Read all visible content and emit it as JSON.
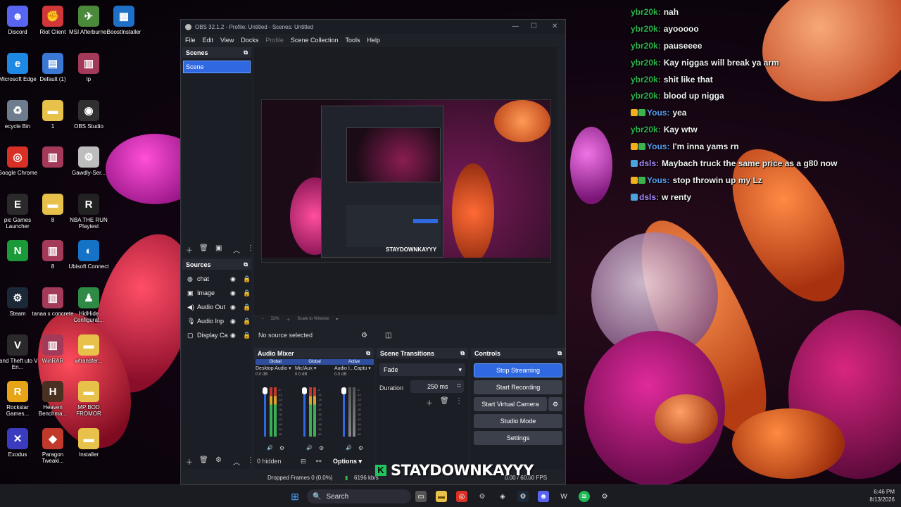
{
  "desktop": {
    "icons": [
      {
        "label": "Discord",
        "glyph": "☻",
        "color": "#5865f2"
      },
      {
        "label": "Riot Client",
        "glyph": "✊",
        "color": "#d13639"
      },
      {
        "label": "MSI Afterburner",
        "glyph": "✈",
        "color": "#4a8a3a"
      },
      {
        "label": "BoostInstaller",
        "glyph": "▦",
        "color": "#1f6fc5"
      },
      {
        "label": "Microsoft Edge",
        "glyph": "e",
        "color": "#1e88e5"
      },
      {
        "label": "Default (1)",
        "glyph": "▤",
        "color": "#3a78d4"
      },
      {
        "label": "lp",
        "glyph": "▥",
        "color": "#a33a5a"
      },
      {
        "label": "ecycle Bin",
        "glyph": "♻",
        "color": "#6e7d8e"
      },
      {
        "label": "1",
        "glyph": "▬",
        "color": "#e7c14a"
      },
      {
        "label": "OBS Studio",
        "glyph": "◉",
        "color": "#303030"
      },
      {
        "label": "Google Chrome",
        "glyph": "◎",
        "color": "#d93025"
      },
      {
        "label": "",
        "glyph": "▥",
        "color": "#a33a5a"
      },
      {
        "label": "Gawdly-Ser...",
        "glyph": "⚙",
        "color": "#bdbdbd"
      },
      {
        "label": "pic Games Launcher",
        "glyph": "E",
        "color": "#2a2a2a"
      },
      {
        "label": "8",
        "glyph": "▬",
        "color": "#e7c14a"
      },
      {
        "label": "NBA THE RUN Playtest",
        "glyph": "R",
        "color": "#222"
      },
      {
        "label": "",
        "glyph": "N",
        "color": "#1b9a3a"
      },
      {
        "label": "8",
        "glyph": "▥",
        "color": "#a33a5a"
      },
      {
        "label": "Ubisoft Connect",
        "glyph": "◐",
        "color": "#1573c7"
      },
      {
        "label": "Steam",
        "glyph": "⚙",
        "color": "#1b2838"
      },
      {
        "label": "tanaa x concrete",
        "glyph": "▥",
        "color": "#a33a5a"
      },
      {
        "label": "HidHide Configurat...",
        "glyph": "♟",
        "color": "#2f8a45"
      },
      {
        "label": "rand Theft uto V En...",
        "glyph": "V",
        "color": "#2a2a2a"
      },
      {
        "label": "WinRAR",
        "glyph": "▥",
        "color": "#a33a5a"
      },
      {
        "label": "wtransfer...",
        "glyph": "▬",
        "color": "#e7c14a"
      },
      {
        "label": "Rockstar Games...",
        "glyph": "R",
        "color": "#e6a416"
      },
      {
        "label": "Heaven Benchma...",
        "glyph": "H",
        "color": "#4a3020"
      },
      {
        "label": "MP BOD FROMOR",
        "glyph": "▬",
        "color": "#e7c14a"
      },
      {
        "label": "Exodus",
        "glyph": "✕",
        "color": "#3b3bc0"
      },
      {
        "label": "Paragon Tweaki...",
        "glyph": "◆",
        "color": "#c0392b"
      },
      {
        "label": "Installer",
        "glyph": "▬",
        "color": "#e7c14a"
      }
    ]
  },
  "chat": {
    "messages": [
      {
        "user": "ybr20k:",
        "user_color": "#2fb24e",
        "text": "nah",
        "badges": []
      },
      {
        "user": "ybr20k:",
        "user_color": "#2fb24e",
        "text": "ayooooo",
        "badges": []
      },
      {
        "user": "ybr20k:",
        "user_color": "#2fb24e",
        "text": "pauseeee",
        "badges": []
      },
      {
        "user": "ybr20k:",
        "user_color": "#2fb24e",
        "text": "Kay niggas will break ya arm",
        "badges": []
      },
      {
        "user": "ybr20k:",
        "user_color": "#2fb24e",
        "text": "shit like that",
        "badges": []
      },
      {
        "user": "ybr20k:",
        "user_color": "#2fb24e",
        "text": "blood up nigga",
        "badges": []
      },
      {
        "user": "Yous:",
        "user_color": "#5a9ff5",
        "text": "yea",
        "badges": [
          "#f2b01e",
          "#3cb44b"
        ]
      },
      {
        "user": "ybr20k:",
        "user_color": "#2fb24e",
        "text": "Kay wtw",
        "badges": []
      },
      {
        "user": "Yous:",
        "user_color": "#5a9ff5",
        "text": "I'm inna yams rn",
        "badges": [
          "#f2b01e",
          "#3cb44b"
        ]
      },
      {
        "user": "dsls:",
        "user_color": "#a78bfa",
        "text": "Maybach truck the same price as a g80 now",
        "badges": [
          "#4aa3df"
        ]
      },
      {
        "user": "Yous:",
        "user_color": "#5a9ff5",
        "text": "stop throwin up my Lz",
        "badges": [
          "#f2b01e",
          "#3cb44b"
        ]
      },
      {
        "user": "dsls:",
        "user_color": "#a78bfa",
        "text": "w renty",
        "badges": [
          "#4aa3df"
        ]
      }
    ]
  },
  "obs": {
    "title": "OBS 32.1.2 - Profile: Untitled - Scenes: Untitled",
    "menu": [
      "File",
      "Edit",
      "View",
      "Docks",
      "Profile",
      "Scene Collection",
      "Tools",
      "Help"
    ],
    "scenes_header": "Scenes",
    "scene_item": "Scene",
    "sources_header": "Sources",
    "sources": [
      {
        "label": "chat",
        "icon": "◍"
      },
      {
        "label": "Image",
        "icon": "▣"
      },
      {
        "label": "Audio Out",
        "icon": "◀)"
      },
      {
        "label": "Audio Inp",
        "icon": "🎙"
      },
      {
        "label": "Display Ca",
        "icon": "▢"
      }
    ],
    "preview_stream_title": "STAYDOWNKAYYY",
    "zoom_label": "32%",
    "scale_label": "Scale to Window",
    "no_source": "No source selected",
    "mixer": {
      "header": "Audio Mixer",
      "channels": [
        {
          "tag": "Global",
          "name": "Desktop Audio",
          "db": "0.0 dB"
        },
        {
          "tag": "Global",
          "name": "Mic/Aux",
          "db": "0.0 dB"
        },
        {
          "tag": "Active",
          "name": "Audio I...Captu",
          "db": "0.0 dB"
        }
      ],
      "scale": [
        "-6",
        "-12",
        "-18",
        "-24",
        "-30",
        "-36",
        "-42",
        "-48",
        "-54",
        "-60"
      ],
      "hidden_count": "0 hidden",
      "options_label": "Options"
    },
    "transitions": {
      "header": "Scene Transitions",
      "selected": "Fade",
      "duration_label": "Duration",
      "duration_value": "250 ms"
    },
    "controls": {
      "header": "Controls",
      "stop_streaming": "Stop Streaming",
      "start_recording": "Start Recording",
      "start_virtual_camera": "Start Virtual Camera",
      "studio_mode": "Studio Mode",
      "settings": "Settings"
    },
    "status": {
      "dropped": "Dropped Frames 0 (0.0%)",
      "bitrate": "6196 kb/s",
      "fps": "0.00 / 60.00 FPS"
    }
  },
  "overlay": {
    "brand": "STAYDOWNKAYYY",
    "brand_color": "#21c55d"
  },
  "taskbar": {
    "search_placeholder": "Search",
    "time": "6:46 PM",
    "date": "8/13/2026"
  }
}
